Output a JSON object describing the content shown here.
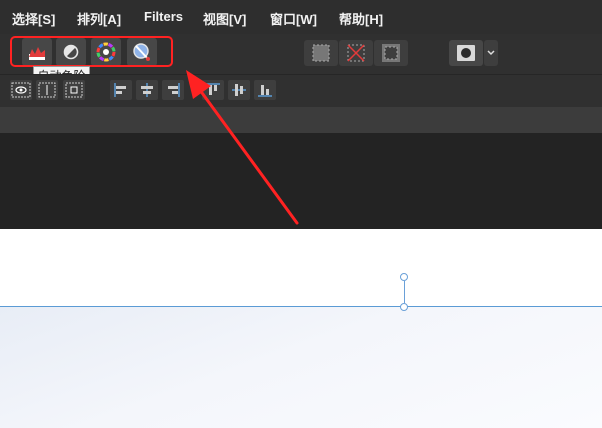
{
  "menu": {
    "items": [
      {
        "label": "选择[S]"
      },
      {
        "label": "排列[A]"
      },
      {
        "label": "Filters"
      },
      {
        "label": "视图[V]"
      },
      {
        "label": "窗口[W]"
      },
      {
        "label": "帮助[H]"
      }
    ]
  },
  "toolbar": {
    "tooltip": "自动色阶",
    "icons": [
      "auto-levels-icon",
      "auto-contrast-icon",
      "auto-color-icon",
      "auto-white-balance-icon"
    ],
    "selection_icons": [
      "select-all-icon",
      "deselect-icon",
      "invert-selection-icon"
    ],
    "mask_icon": "quick-mask-icon"
  },
  "colors": {
    "highlight": "#ff2222",
    "arrow": "#ff2222",
    "guide": "#5b9bd5",
    "menubar_bg": "#2e2e2e"
  }
}
